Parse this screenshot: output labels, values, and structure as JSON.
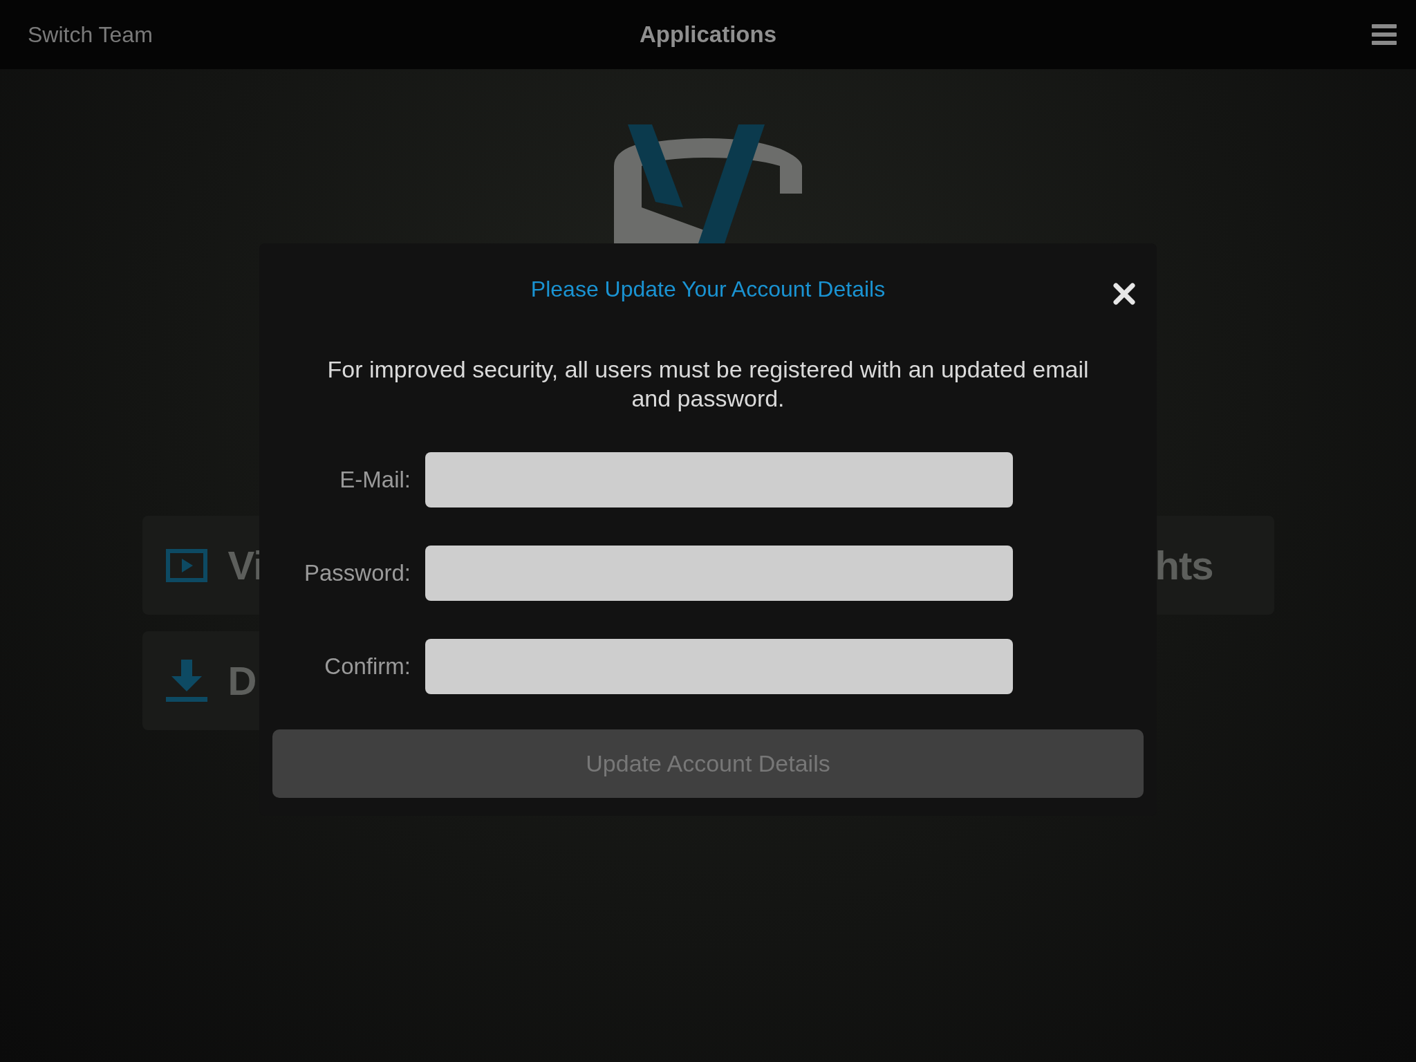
{
  "top_bar": {
    "left": "Switch Team",
    "title": "Applications"
  },
  "tiles": [
    {
      "kind": "video",
      "label": "Vi"
    },
    {
      "kind": "highlights",
      "label": "hts"
    },
    {
      "kind": "download",
      "label": "D"
    }
  ],
  "dialog": {
    "title": "Please Update Your Account Details",
    "message": "For improved security, all users must be registered with an updated email and password.",
    "fields": [
      {
        "label": "E-Mail:"
      },
      {
        "label": "Password:"
      },
      {
        "label": "Confirm:"
      }
    ],
    "submit": {
      "label": "Update Account Details",
      "disabled": true
    }
  }
}
